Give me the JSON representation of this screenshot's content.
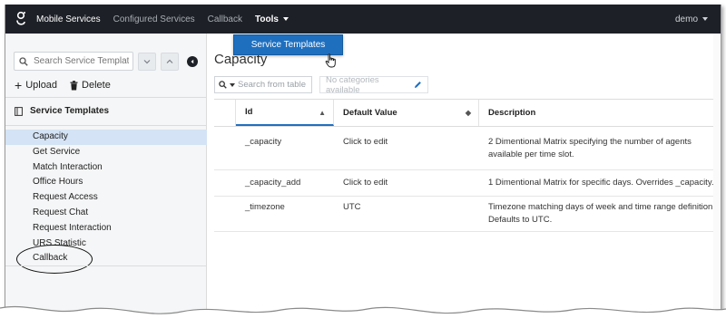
{
  "topbar": {
    "brand": "Mobile Services",
    "nav": [
      "Configured Services",
      "Callback"
    ],
    "active_menu": "Tools",
    "user": "demo"
  },
  "dropdown": {
    "item": "Service Templates"
  },
  "sidebar": {
    "search_placeholder": "Search Service Templates",
    "upload_label": "Upload",
    "delete_label": "Delete",
    "section_title": "Service Templates",
    "items": [
      "Capacity",
      "Get Service",
      "Match Interaction",
      "Office Hours",
      "Request Access",
      "Request Chat",
      "Request Interaction",
      "URS Statistic",
      "Callback"
    ],
    "selected_index": 0
  },
  "main": {
    "title": "Capacity",
    "search_placeholder": "Search from table",
    "categories_text": "No categories available",
    "table": {
      "headers": [
        "Id",
        "Default Value",
        "Description"
      ],
      "rows": [
        {
          "id": "_capacity",
          "default": "Click to edit",
          "description": "2 Dimentional Matrix specifying the number of agents available per time slot."
        },
        {
          "id": "_capacity_add",
          "default": "Click to edit",
          "description": "1 Dimentional Matrix for specific days. Overrides _capacity."
        },
        {
          "id": "_timezone",
          "default": "UTC",
          "description": "Timezone matching days of week and time range definition. Defaults to UTC."
        }
      ]
    }
  },
  "colors": {
    "topbar": "#1d2027",
    "accent": "#1f6fbf",
    "selected_row": "#d4e3f5"
  }
}
